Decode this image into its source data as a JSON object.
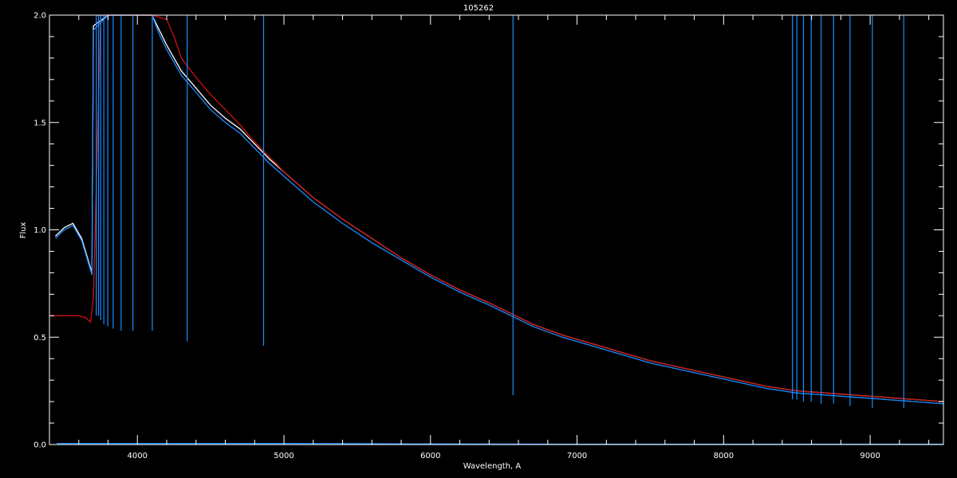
{
  "chart_data": {
    "type": "line",
    "title": "105262",
    "xlabel": "Wavelength, A",
    "ylabel": "Flux",
    "xlim": [
      3400,
      9500
    ],
    "ylim": [
      0.0,
      2.0
    ],
    "x_ticks": [
      4000,
      5000,
      6000,
      7000,
      8000,
      9000
    ],
    "y_ticks": [
      0.0,
      0.5,
      1.0,
      1.5,
      2.0
    ],
    "x_tick_labels": [
      "4000",
      "5000",
      "6000",
      "7000",
      "8000",
      "9000"
    ],
    "y_tick_labels": [
      "0.0",
      "0.5",
      "1.0",
      "1.5",
      "2.0"
    ],
    "grid": false,
    "series": [
      {
        "color": "#ffffff",
        "x": [
          3440,
          3500,
          3560,
          3620,
          3690,
          3700,
          3800,
          3900,
          4000,
          4100,
          4150,
          4200,
          4250,
          4300,
          4400,
          4500,
          4600,
          4700,
          4800,
          4900,
          5000,
          5200,
          5400,
          5600,
          5800,
          6000,
          6200,
          6400,
          6550,
          6700,
          6900,
          7100,
          7300,
          7500,
          7700,
          7900,
          8100,
          8300,
          8500,
          8700,
          8900,
          9100,
          9300,
          9500
        ],
        "y": [
          0.97,
          1.01,
          1.03,
          0.96,
          0.8,
          1.95,
          2.0,
          2.0,
          2.0,
          2.0,
          1.93,
          1.86,
          1.8,
          1.74,
          1.66,
          1.58,
          1.52,
          1.47,
          1.4,
          1.33,
          1.27,
          1.15,
          1.05,
          0.96,
          0.87,
          0.79,
          0.72,
          0.66,
          0.61,
          0.56,
          0.51,
          0.47,
          0.43,
          0.39,
          0.36,
          0.33,
          0.3,
          0.27,
          0.25,
          0.24,
          0.23,
          0.22,
          0.21,
          0.2
        ]
      },
      {
        "color": "#1a8cff",
        "x": [
          3440,
          3500,
          3560,
          3620,
          3690,
          3700,
          3800,
          3900,
          4000,
          4100,
          4150,
          4200,
          4250,
          4300,
          4400,
          4500,
          4600,
          4700,
          4800,
          4900,
          5000,
          5200,
          5400,
          5600,
          5800,
          6000,
          6200,
          6400,
          6550,
          6700,
          6900,
          7100,
          7300,
          7500,
          7700,
          7900,
          8100,
          8300,
          8500,
          8700,
          8900,
          9100,
          9300,
          9500
        ],
        "y": [
          0.96,
          1.0,
          1.02,
          0.95,
          0.79,
          1.93,
          2.0,
          2.0,
          2.0,
          2.0,
          1.91,
          1.84,
          1.78,
          1.72,
          1.64,
          1.56,
          1.5,
          1.45,
          1.38,
          1.31,
          1.25,
          1.13,
          1.03,
          0.94,
          0.86,
          0.78,
          0.71,
          0.65,
          0.6,
          0.55,
          0.5,
          0.46,
          0.42,
          0.38,
          0.35,
          0.32,
          0.29,
          0.26,
          0.24,
          0.23,
          0.22,
          0.21,
          0.2,
          0.19
        ]
      },
      {
        "color": "#cc1111",
        "x": [
          3400,
          3500,
          3600,
          3650,
          3680,
          3700,
          3750,
          3800,
          3900,
          4000,
          4100,
          4200,
          4250,
          4300,
          4400,
          4500,
          4600,
          4700,
          4800,
          4900,
          5000,
          5200,
          5400,
          5600,
          5800,
          6000,
          6200,
          6400,
          6550,
          6700,
          6900,
          7100,
          7300,
          7500,
          7700,
          7900,
          8100,
          8300,
          8500,
          8700,
          8900,
          9100,
          9300,
          9500
        ],
        "y": [
          0.6,
          0.6,
          0.6,
          0.59,
          0.57,
          0.68,
          2.0,
          2.0,
          2.0,
          2.0,
          2.0,
          1.98,
          1.9,
          1.8,
          1.71,
          1.63,
          1.56,
          1.49,
          1.41,
          1.34,
          1.27,
          1.15,
          1.05,
          0.96,
          0.87,
          0.79,
          0.72,
          0.66,
          0.61,
          0.56,
          0.51,
          0.47,
          0.43,
          0.39,
          0.36,
          0.33,
          0.3,
          0.27,
          0.25,
          0.24,
          0.23,
          0.22,
          0.21,
          0.2
        ]
      },
      {
        "color": "#1a8cff",
        "x": [
          3450,
          4000,
          5000,
          5500,
          6000,
          7000,
          8000,
          9000,
          9500
        ],
        "y": [
          0.005,
          0.005,
          0.005,
          0.004,
          0.003,
          0.002,
          0.002,
          0.002,
          0.002
        ]
      }
    ],
    "absorption_lines": [
      {
        "x": 3720,
        "depth": 0.6
      },
      {
        "x": 3735,
        "depth": 0.6
      },
      {
        "x": 3750,
        "depth": 0.58
      },
      {
        "x": 3771,
        "depth": 0.56
      },
      {
        "x": 3798,
        "depth": 0.55
      },
      {
        "x": 3835,
        "depth": 0.54
      },
      {
        "x": 3889,
        "depth": 0.53
      },
      {
        "x": 3970,
        "depth": 0.53
      },
      {
        "x": 4102,
        "depth": 0.53
      },
      {
        "x": 4340,
        "depth": 0.48
      },
      {
        "x": 4861,
        "depth": 0.46
      },
      {
        "x": 6563,
        "depth": 0.23
      },
      {
        "x": 8470,
        "depth": 0.21
      },
      {
        "x": 8500,
        "depth": 0.21
      },
      {
        "x": 8545,
        "depth": 0.2
      },
      {
        "x": 8598,
        "depth": 0.2
      },
      {
        "x": 8665,
        "depth": 0.19
      },
      {
        "x": 8750,
        "depth": 0.19
      },
      {
        "x": 8863,
        "depth": 0.18
      },
      {
        "x": 9015,
        "depth": 0.17
      },
      {
        "x": 9229,
        "depth": 0.17
      }
    ]
  }
}
